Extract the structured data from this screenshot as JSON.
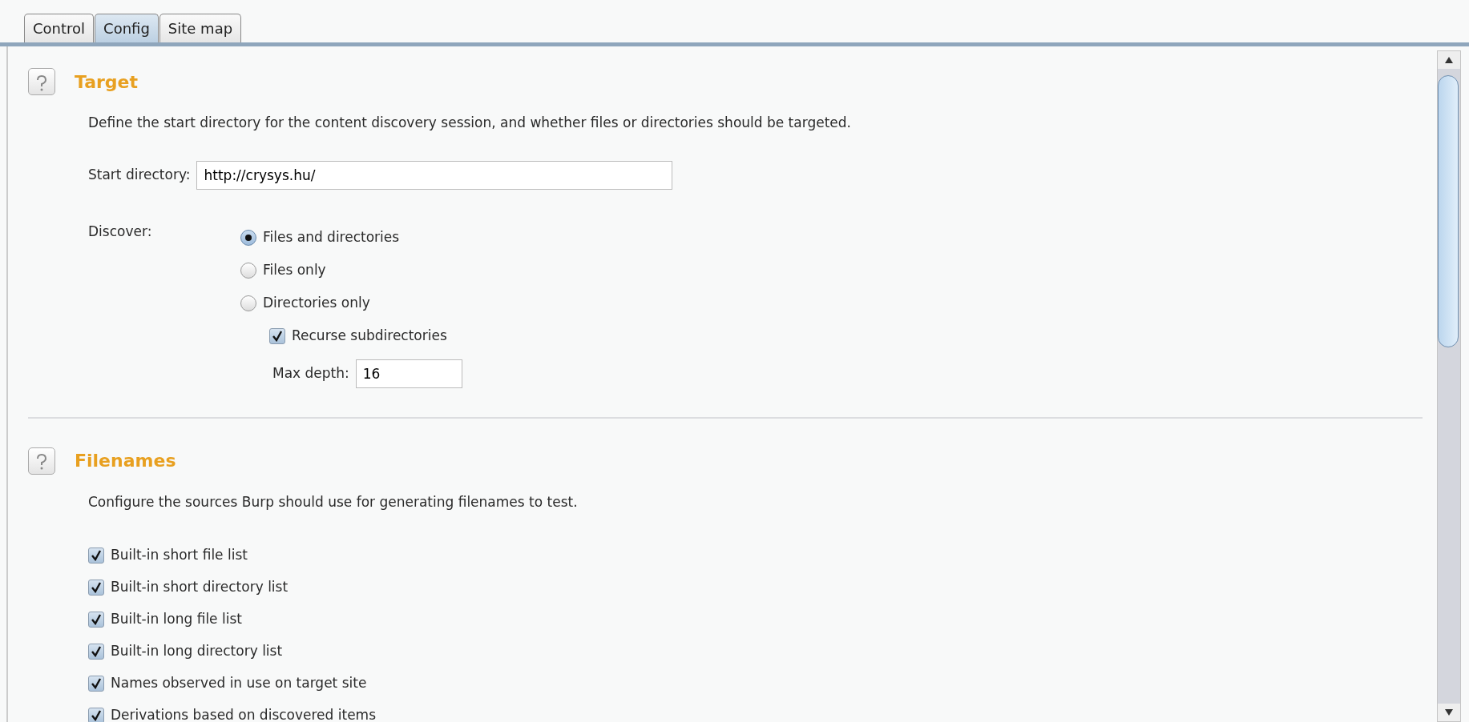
{
  "tabs": [
    {
      "label": "Control",
      "selected": false
    },
    {
      "label": "Config",
      "selected": true
    },
    {
      "label": "Site map",
      "selected": false
    }
  ],
  "sections": [
    {
      "title": "Target",
      "description": "Define the start directory for the content discovery session, and whether files or directories should be targeted.",
      "start_directory": {
        "label": "Start directory:",
        "value": "http://crysys.hu/"
      },
      "discover": {
        "label": "Discover:",
        "options": [
          {
            "label": "Files and directories",
            "selected": true
          },
          {
            "label": "Files only",
            "selected": false
          },
          {
            "label": "Directories only",
            "selected": false
          }
        ]
      },
      "recurse": {
        "label": "Recurse subdirectories",
        "checked": true
      },
      "max_depth": {
        "label": "Max depth:",
        "value": "16"
      }
    },
    {
      "title": "Filenames",
      "description": "Configure the sources Burp should use for generating filenames to test.",
      "sources": [
        {
          "label": "Built-in short file list",
          "checked": true
        },
        {
          "label": "Built-in short directory list",
          "checked": true
        },
        {
          "label": "Built-in long file list",
          "checked": true
        },
        {
          "label": "Built-in long directory list",
          "checked": true
        },
        {
          "label": "Names observed in use on target site",
          "checked": true
        },
        {
          "label": "Derivations based on discovered items",
          "checked": true
        }
      ]
    }
  ]
}
